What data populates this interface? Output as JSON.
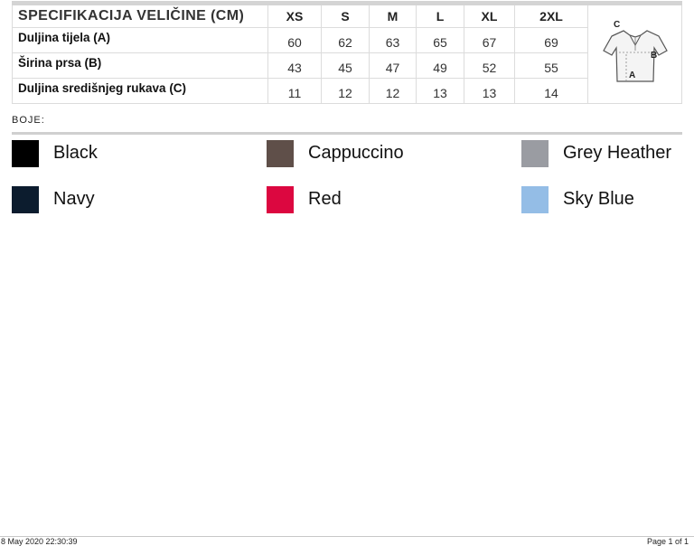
{
  "size_table": {
    "title": "SPECIFIKACIJA VELIČINE (CM)",
    "sizes": [
      "XS",
      "S",
      "M",
      "L",
      "XL",
      "2XL"
    ],
    "rows": [
      {
        "label": "Duljina tijela (A)",
        "values": [
          "60",
          "62",
          "63",
          "65",
          "67",
          "69"
        ]
      },
      {
        "label": "Širina prsa (B)",
        "values": [
          "43",
          "45",
          "47",
          "49",
          "52",
          "55"
        ]
      },
      {
        "label": "Duljina središnjeg rukava (C)",
        "values": [
          "11",
          "12",
          "12",
          "13",
          "13",
          "14"
        ]
      }
    ],
    "diagram": {
      "icon": "polo-shirt-measurement-icon",
      "labels": [
        "C",
        "B",
        "A"
      ]
    }
  },
  "colors": {
    "label": "BOJE:",
    "items": [
      {
        "name": "Black",
        "hex": "#000000"
      },
      {
        "name": "Cappuccino",
        "hex": "#5f4f49"
      },
      {
        "name": "Grey Heather",
        "hex": "#9a9ca2"
      },
      {
        "name": "Navy",
        "hex": "#0c1c2e"
      },
      {
        "name": "Red",
        "hex": "#dc0740"
      },
      {
        "name": "Sky Blue",
        "hex": "#94bde6"
      }
    ]
  },
  "footer": {
    "timestamp": "8 May 2020 22:30:39",
    "page": "Page 1 of 1"
  }
}
